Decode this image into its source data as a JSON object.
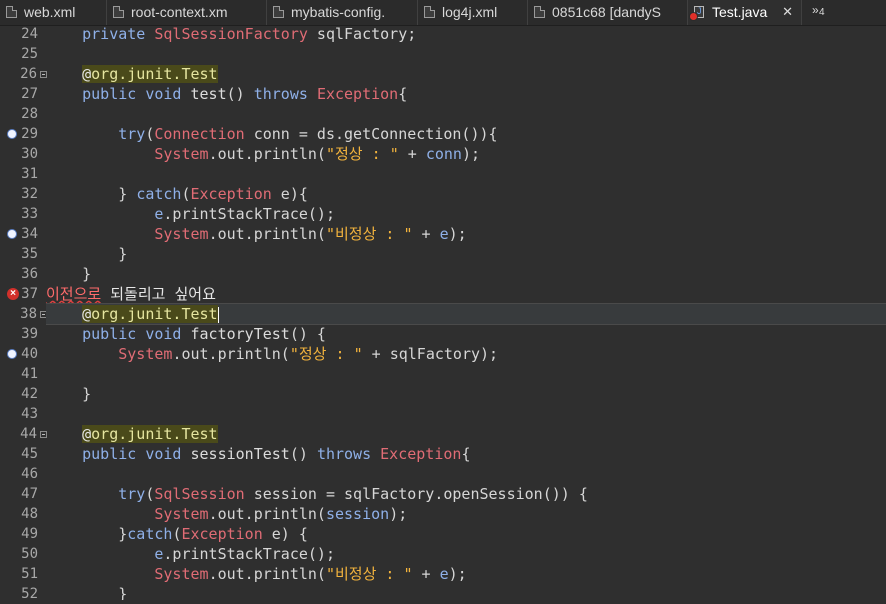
{
  "tabs": [
    {
      "label": "web.xml",
      "active": false
    },
    {
      "label": "root-context.xm",
      "active": false
    },
    {
      "label": "mybatis-config.",
      "active": false
    },
    {
      "label": "log4j.xml",
      "active": false
    },
    {
      "label": "0851c68 [dandyS",
      "active": false
    },
    {
      "label": "Test.java",
      "active": true,
      "close": "✕"
    }
  ],
  "overflow": {
    "symbol": "»",
    "count": "4"
  },
  "lines": [
    {
      "n": "24",
      "marker": ""
    },
    {
      "n": "25",
      "marker": ""
    },
    {
      "n": "26",
      "marker": "fold"
    },
    {
      "n": "27",
      "marker": ""
    },
    {
      "n": "28",
      "marker": ""
    },
    {
      "n": "29",
      "marker": "breakpoint"
    },
    {
      "n": "30",
      "marker": ""
    },
    {
      "n": "31",
      "marker": ""
    },
    {
      "n": "32",
      "marker": ""
    },
    {
      "n": "33",
      "marker": ""
    },
    {
      "n": "34",
      "marker": "breakpoint"
    },
    {
      "n": "35",
      "marker": ""
    },
    {
      "n": "36",
      "marker": ""
    },
    {
      "n": "37",
      "marker": "error"
    },
    {
      "n": "38",
      "marker": "fold"
    },
    {
      "n": "39",
      "marker": ""
    },
    {
      "n": "40",
      "marker": "breakpoint"
    },
    {
      "n": "41",
      "marker": ""
    },
    {
      "n": "42",
      "marker": ""
    },
    {
      "n": "43",
      "marker": ""
    },
    {
      "n": "44",
      "marker": "fold"
    },
    {
      "n": "45",
      "marker": ""
    },
    {
      "n": "46",
      "marker": ""
    },
    {
      "n": "47",
      "marker": ""
    },
    {
      "n": "48",
      "marker": ""
    },
    {
      "n": "49",
      "marker": ""
    },
    {
      "n": "50",
      "marker": ""
    },
    {
      "n": "51",
      "marker": ""
    },
    {
      "n": "52",
      "marker": ""
    }
  ],
  "code": {
    "l24": {
      "indent": "    ",
      "kw": "private ",
      "ty": "SqlSessionFactory",
      "rest": " sqlFactory;"
    },
    "l26": {
      "indent": "    ",
      "at": "@",
      "annot": "org.junit.Test"
    },
    "l27": {
      "indent": "    ",
      "kw": "public void ",
      "fn": "test",
      "paren": "() ",
      "kw2": "throws ",
      "ty": "Exception",
      "rest": "{"
    },
    "l29": {
      "indent": "        ",
      "kw": "try",
      "p1": "(",
      "ty": "Connection",
      "rest": " conn = ds.getConnection()){"
    },
    "l30": {
      "indent": "            ",
      "ty": "System",
      "mid": ".out.println(",
      "st": "\"정상 : \"",
      "plus": " + ",
      "vr": "conn",
      "end": ");"
    },
    "l32": {
      "indent": "        ",
      "pre": "} ",
      "kw": "catch",
      "p1": "(",
      "ty": "Exception",
      "rest": " e){"
    },
    "l33": {
      "indent": "            ",
      "vr": "e",
      "rest": ".printStackTrace();"
    },
    "l34": {
      "indent": "            ",
      "ty": "System",
      "mid": ".out.println(",
      "st": "\"비정상 : \"",
      "plus": " + ",
      "vr": "e",
      "end": ");"
    },
    "l35": {
      "indent": "        ",
      "text": "}"
    },
    "l36": {
      "indent": "    ",
      "text": "}"
    },
    "l37": {
      "ko": "이전으로",
      "rest": " 되돌리고 싶어요"
    },
    "l38": {
      "indent": "    ",
      "at": "@",
      "annot": "org.junit.Test"
    },
    "l39": {
      "indent": "    ",
      "kw": "public void ",
      "fn": "factoryTest",
      "rest": "() {"
    },
    "l40": {
      "indent": "        ",
      "ty": "System",
      "mid": ".out.println(",
      "st": "\"정상 : \"",
      "plus": " + ",
      "vr": "sqlFactory",
      "end": ");"
    },
    "l42": {
      "indent": "    ",
      "text": "}"
    },
    "l44": {
      "indent": "    ",
      "at": "@",
      "annot": "org.junit.Test"
    },
    "l45": {
      "indent": "    ",
      "kw": "public void ",
      "fn": "sessionTest",
      "paren": "() ",
      "kw2": "throws ",
      "ty": "Exception",
      "rest": "{"
    },
    "l47": {
      "indent": "        ",
      "kw": "try",
      "p1": "(",
      "ty": "SqlSession",
      "rest": " session = sqlFactory.openSession()) {"
    },
    "l48": {
      "indent": "            ",
      "ty": "System",
      "mid": ".out.println(",
      "vr": "session",
      "end": ");"
    },
    "l49": {
      "indent": "        ",
      "pre": "}",
      "kw": "catch",
      "p1": "(",
      "ty": "Exception",
      "rest": " e) {"
    },
    "l50": {
      "indent": "            ",
      "vr": "e",
      "rest": ".printStackTrace();"
    },
    "l51": {
      "indent": "            ",
      "ty": "System",
      "mid": ".out.println(",
      "st": "\"비정상 : \"",
      "plus": " + ",
      "vr": "e",
      "end": ");"
    },
    "l52": {
      "indent": "        ",
      "text": "}"
    }
  },
  "colors": {
    "keyword": "#8fb0e8",
    "type": "#e06c75",
    "string": "#f2b33d",
    "annotation_bg": "#4a4a1a",
    "error": "#d2302b",
    "breakpoint": "#5b7fc4"
  }
}
